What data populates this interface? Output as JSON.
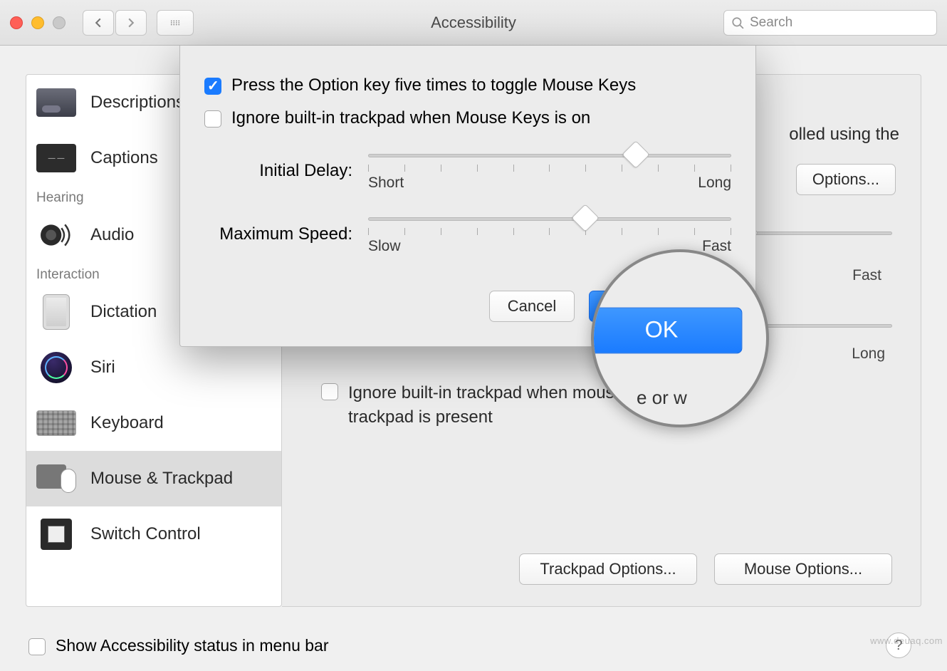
{
  "window": {
    "title": "Accessibility",
    "search_placeholder": "Search"
  },
  "sidebar": {
    "groups": [
      {
        "header": "",
        "items": [
          {
            "label": "Descriptions"
          },
          {
            "label": "Captions"
          }
        ]
      },
      {
        "header": "Hearing",
        "items": [
          {
            "label": "Audio"
          }
        ]
      },
      {
        "header": "Interaction",
        "items": [
          {
            "label": "Dictation"
          },
          {
            "label": "Siri"
          },
          {
            "label": "Keyboard"
          },
          {
            "label": "Mouse & Trackpad"
          },
          {
            "label": "Switch Control"
          }
        ]
      }
    ]
  },
  "background_panel": {
    "partial_text": "olled using the",
    "options_button": "Options...",
    "slider1_right": "Fast",
    "slider2_right": "Long",
    "ignore_label": "Ignore built-in trackpad when mouse or wireless trackpad is present",
    "trackpad_options": "Trackpad Options...",
    "mouse_options": "Mouse Options..."
  },
  "sheet": {
    "checkbox1": "Press the Option key five times to toggle Mouse Keys",
    "checkbox2": "Ignore built-in trackpad when Mouse Keys is on",
    "slider1": {
      "label": "Initial Delay:",
      "left": "Short",
      "right": "Long"
    },
    "slider2": {
      "label": "Maximum Speed:",
      "left": "Slow",
      "right": "Fast"
    },
    "cancel": "Cancel",
    "ok": "OK"
  },
  "magnifier_snippet": "e or w",
  "footer": {
    "show_status": "Show Accessibility status in menu bar",
    "help": "?"
  },
  "watermark": "www.deuaq.com"
}
